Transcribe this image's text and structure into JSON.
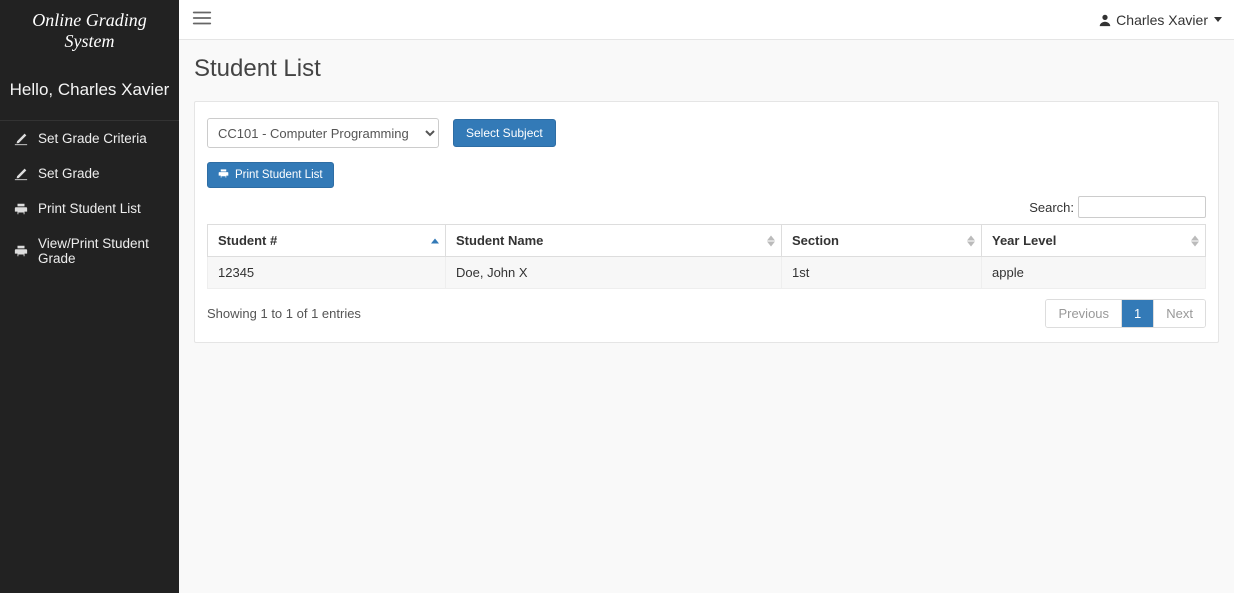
{
  "brand": "Online Grading System",
  "greeting": "Hello, Charles Xavier",
  "user_menu": {
    "name": "Charles Xavier"
  },
  "sidebar": {
    "items": [
      {
        "label": "Set Grade Criteria",
        "icon": "edit-icon"
      },
      {
        "label": "Set Grade",
        "icon": "edit-icon"
      },
      {
        "label": "Print Student List",
        "icon": "print-icon"
      },
      {
        "label": "View/Print Student Grade",
        "icon": "print-icon"
      }
    ]
  },
  "page": {
    "title": "Student List"
  },
  "subject_select": {
    "selected": "CC101 - Computer Programming"
  },
  "buttons": {
    "select_subject": "Select Subject",
    "print_student_list": "Print Student List"
  },
  "search": {
    "label": "Search:",
    "value": ""
  },
  "table": {
    "columns": [
      "Student #",
      "Student Name",
      "Section",
      "Year Level"
    ],
    "rows": [
      {
        "student_no": "12345",
        "student_name": "Doe, John X",
        "section": "1st",
        "year_level": "apple"
      }
    ]
  },
  "footer": {
    "info": "Showing 1 to 1 of 1 entries",
    "pagination": {
      "previous": "Previous",
      "next": "Next",
      "current": "1"
    }
  },
  "colors": {
    "primary": "#337ab7",
    "sidebar_bg": "#222222"
  }
}
